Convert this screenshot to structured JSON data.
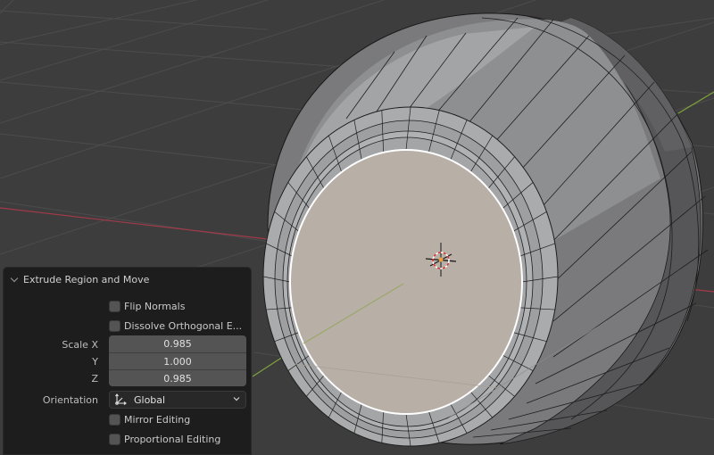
{
  "viewport": {
    "background": "#3d3d3d",
    "grid_color": "#4d4d4d",
    "x_axis_color": "#a23a4a",
    "y_axis_color": "#7fa23c",
    "selected_face_color": "#b8afa6",
    "selection_outline_color": "#ffffff",
    "origin_color": "#f0a040",
    "object_description": "Extruded cylinder mesh in edit mode with selected inset face"
  },
  "operator_panel": {
    "title": "Extrude Region and Move",
    "collapse_icon": "chevron-down-icon",
    "flip_normals": {
      "label": "Flip Normals",
      "checked": false
    },
    "dissolve_orthogonal": {
      "label": "Dissolve Orthogonal E...",
      "checked": false
    },
    "scale": {
      "label_x": "Scale X",
      "label_y": "Y",
      "label_z": "Z",
      "x": "0.985",
      "y": "1.000",
      "z": "0.985"
    },
    "orientation": {
      "label": "Orientation",
      "value": "Global",
      "icon": "orientation-global-icon"
    },
    "mirror_editing": {
      "label": "Mirror Editing",
      "checked": false
    },
    "proportional_editing": {
      "label": "Proportional Editing",
      "checked": false
    }
  }
}
